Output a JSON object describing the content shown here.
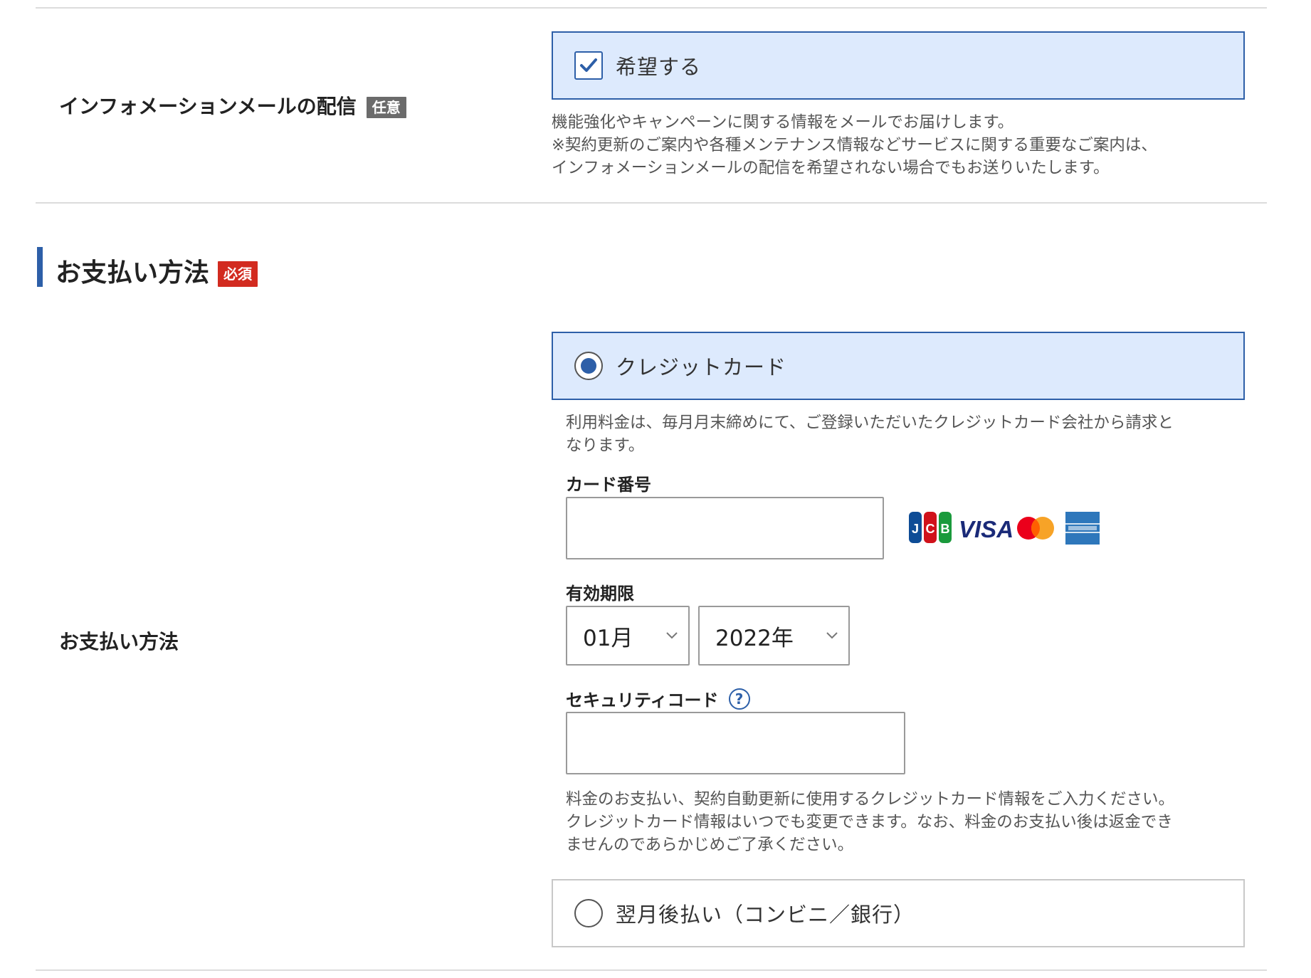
{
  "info_mail": {
    "label": "インフォメーションメールの配信",
    "badge": "任意",
    "option_label": "希望する",
    "checked": true,
    "help_lines": [
      "機能強化やキャンペーンに関する情報をメールでお届けします。",
      "※契約更新のご案内や各種メンテナンス情報などサービスに関する重要なご案内は、",
      "インフォメーションメールの配信を希望されない場合でもお送りいたします。"
    ]
  },
  "payment": {
    "section_title": "お支払い方法",
    "section_badge": "必須",
    "row_label": "お支払い方法",
    "credit_card": {
      "option_label": "クレジットカード",
      "selected": true,
      "help_lines": [
        "利用料金は、毎月月末締めにて、ご登録いただいたクレジットカード会社から請求と",
        "なります。"
      ],
      "card_number_label": "カード番号",
      "card_number_value": "",
      "brands": [
        "JCB",
        "VISA",
        "Mastercard",
        "AMERICAN EXPRESS"
      ],
      "expiry_label": "有効期限",
      "expiry_month": "01月",
      "expiry_year": "2022年",
      "security_code_label": "セキュリティコード",
      "security_help_icon": "?",
      "security_code_value": "",
      "note_lines": [
        "料金のお支払い、契約自動更新に使用するクレジットカード情報をご入力ください。",
        "クレジットカード情報はいつでも変更できます。なお、料金のお支払い後は返金でき",
        "ませんのであらかじめご了承ください。"
      ]
    },
    "deferred": {
      "option_label": "翌月後払い（コンビニ／銀行）",
      "selected": false
    }
  },
  "colors": {
    "accent": "#2d5fa8",
    "selected_bg": "#ddeafd",
    "required_badge": "#d22b20",
    "optional_badge": "#6b6b6b"
  }
}
